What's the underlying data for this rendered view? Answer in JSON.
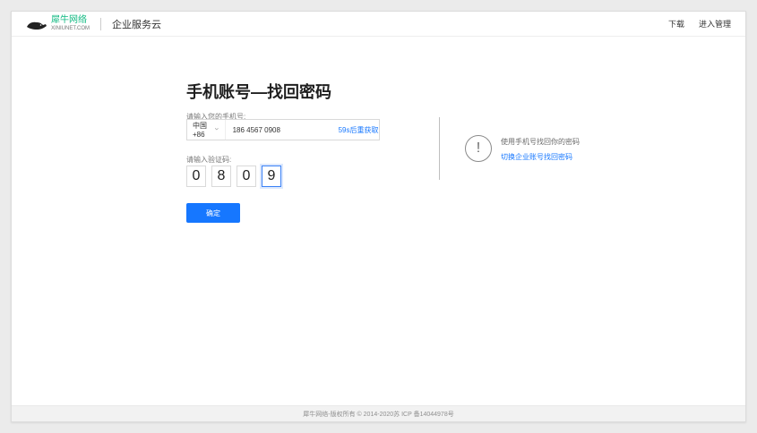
{
  "header": {
    "brand_cn": "犀牛网络",
    "brand_en": "XINIUNET.COM",
    "brand_right": "企业服务云",
    "nav": {
      "download": "下载",
      "login_mgmt": "进入管理"
    }
  },
  "page": {
    "title": "手机账号—找回密码",
    "phone_label": "请输入您的手机号:",
    "country_code": "中国 +86",
    "phone_value": "186 4567 0908",
    "resend_text": "59s后重获取",
    "code_label": "请输入验证码:",
    "code_digits": [
      "0",
      "8",
      "0",
      "9"
    ],
    "confirm_label": "确定"
  },
  "alt": {
    "description": "使用手机号找回你的密码",
    "link": "切换企业账号找回密码"
  },
  "footer": {
    "text": "犀牛网络-版权所有 © 2014-2020苏 ICP 备14044978号"
  },
  "colors": {
    "accent": "#1677ff",
    "brand_green": "#10b981"
  },
  "icons": {
    "logo": "rhino-logo-icon",
    "dropdown": "chevron-down-icon",
    "alert": "exclamation-circle-icon"
  }
}
